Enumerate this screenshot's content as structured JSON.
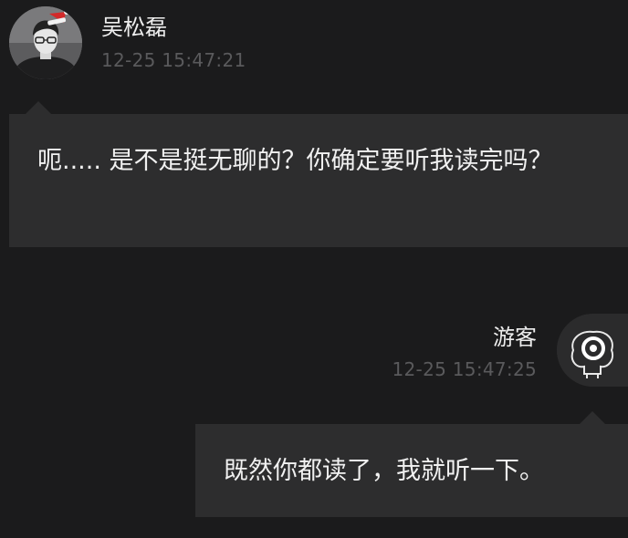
{
  "messages": [
    {
      "sender": "吴松磊",
      "time": "12-25 15:47:21",
      "text": "呃..... 是不是挺无聊的？你确定要听我读完吗？",
      "direction": "incoming",
      "avatar": "user-photo-with-santa-hat"
    },
    {
      "sender": "游客",
      "time": "12-25 15:47:25",
      "text": "既然你都读了，我就听一下。",
      "direction": "outgoing",
      "avatar": "guest-camera-icon"
    }
  ],
  "colors": {
    "background": "#1b1b1c",
    "bubble": "#2d2d2e",
    "name_text": "#ededed",
    "time_text": "#5a5a5c",
    "message_text": "#f1f1f1"
  }
}
